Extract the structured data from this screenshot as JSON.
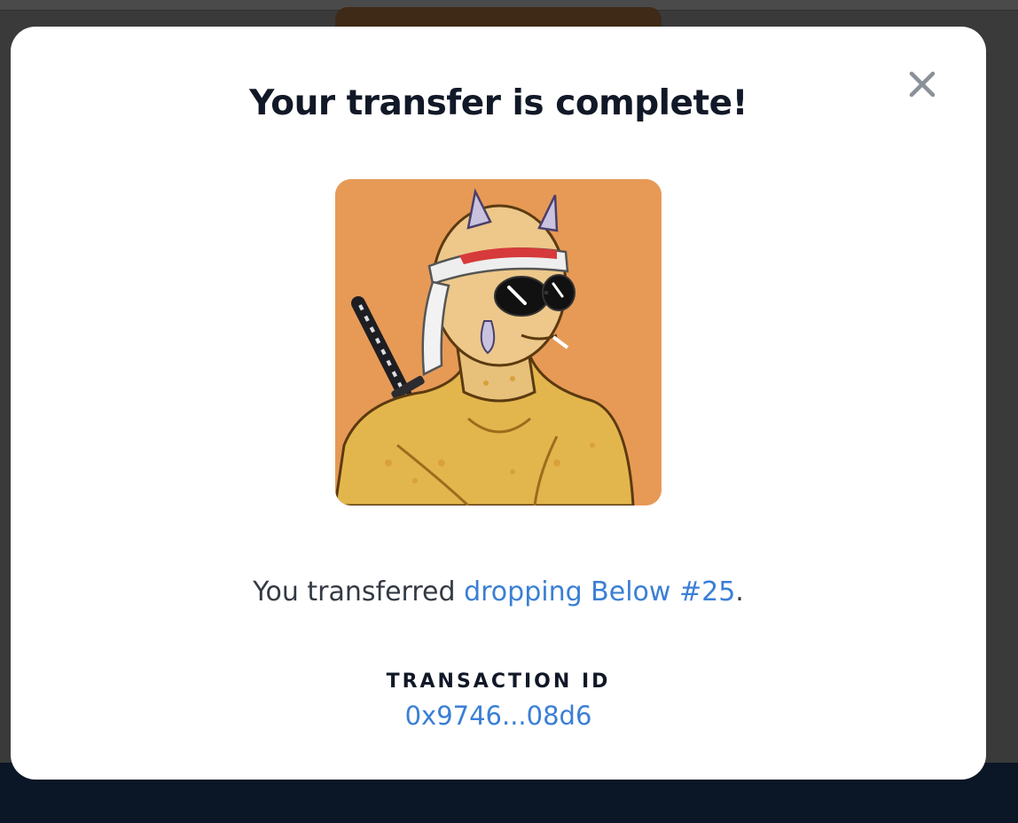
{
  "modal": {
    "title": "Your transfer is complete!",
    "close_icon": "close-icon",
    "nft_image_icon": "nft-artwork"
  },
  "transfer": {
    "prefix": "You transferred ",
    "item_name": "dropping Below #25",
    "suffix": "."
  },
  "transaction": {
    "label": "TRANSACTION ID",
    "id": "0x9746...08d6"
  },
  "colors": {
    "link": "#3a7fd5",
    "title": "#111827",
    "backdrop_footer": "#0b1626",
    "nft_background": "#e79a56"
  }
}
